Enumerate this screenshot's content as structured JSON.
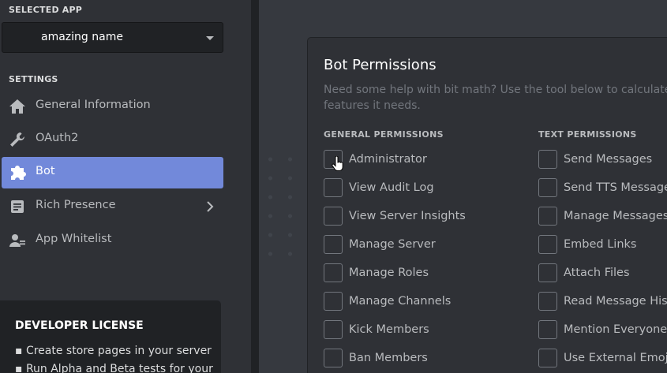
{
  "sidebar": {
    "selected_app_label": "SELECTED APP",
    "selected_app_name": "amazing name",
    "settings_label": "SETTINGS",
    "items": [
      {
        "label": "General Information",
        "icon": "home-icon"
      },
      {
        "label": "OAuth2",
        "icon": "wrench-icon"
      },
      {
        "label": "Bot",
        "icon": "puzzle-icon",
        "active": true
      },
      {
        "label": "Rich Presence",
        "icon": "document-icon"
      },
      {
        "label": "App Whitelist",
        "icon": "user-list-icon"
      }
    ],
    "license": {
      "title": "DEVELOPER LICENSE",
      "lines": [
        "▪ Create store pages in your server",
        "▪ Run Alpha and Beta tests for your"
      ]
    }
  },
  "bot_permissions": {
    "title": "Bot Permissions",
    "description_line1": "Need some help with bit math? Use the tool below to calculate the",
    "description_line2": "features it needs.",
    "general_header": "GENERAL PERMISSIONS",
    "text_header": "TEXT PERMISSIONS",
    "general": [
      "Administrator",
      "View Audit Log",
      "View Server Insights",
      "Manage Server",
      "Manage Roles",
      "Manage Channels",
      "Kick Members",
      "Ban Members"
    ],
    "text": [
      "Send Messages",
      "Send TTS Messages",
      "Manage Messages",
      "Embed Links",
      "Attach Files",
      "Read Message History",
      "Mention Everyone",
      "Use External Emojis"
    ]
  },
  "colors": {
    "accent": "#7289da",
    "sidebar_bg": "#2f3136",
    "main_bg": "#36393f",
    "dark_bg": "#202225"
  }
}
